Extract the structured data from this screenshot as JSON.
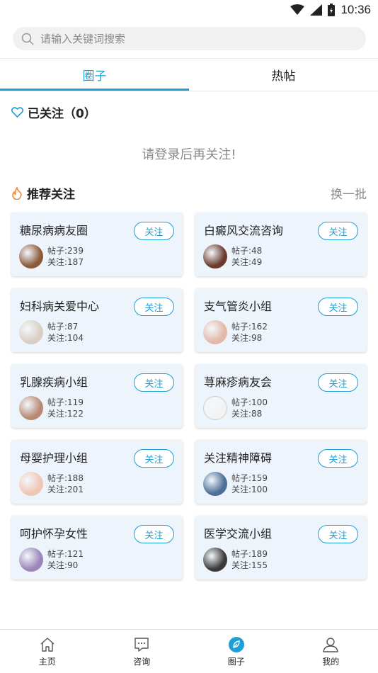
{
  "status_bar": {
    "time": "10:36"
  },
  "search": {
    "placeholder": "请输入关键词搜索"
  },
  "tabs": [
    {
      "label": "圈子",
      "active": true
    },
    {
      "label": "热帖",
      "active": false
    }
  ],
  "followed": {
    "title": "已关注（0）",
    "hint": "请登录后再关注!"
  },
  "recommend": {
    "title": "推荐关注",
    "refresh_label": "换一批"
  },
  "groups": [
    {
      "name": "糖尿病病友圈",
      "button": "关注",
      "posts": "帖子:239",
      "follows": "关注:187",
      "avatar_color": "#8a5a3a"
    },
    {
      "name": "白癜风交流咨询",
      "button": "关注",
      "posts": "帖子:48",
      "follows": "关注:49",
      "avatar_color": "#6b3b2e"
    },
    {
      "name": "妇科病关爱中心",
      "button": "关注",
      "posts": "帖子:87",
      "follows": "关注:104",
      "avatar_color": "#d8cfc2"
    },
    {
      "name": "支气管炎小组",
      "button": "关注",
      "posts": "帖子:162",
      "follows": "关注:98",
      "avatar_color": "#e3b8a8"
    },
    {
      "name": "乳腺疾病小组",
      "button": "关注",
      "posts": "帖子:119",
      "follows": "关注:122",
      "avatar_color": "#b88a74"
    },
    {
      "name": "荨麻疹病友会",
      "button": "关注",
      "posts": "帖子:100",
      "follows": "关注:88",
      "avatar_color": "#f2f2f2"
    },
    {
      "name": "母婴护理小组",
      "button": "关注",
      "posts": "帖子:188",
      "follows": "关注:201",
      "avatar_color": "#f0c6b6"
    },
    {
      "name": "关注精神障碍",
      "button": "关注",
      "posts": "帖子:159",
      "follows": "关注:100",
      "avatar_color": "#4b6f95"
    },
    {
      "name": "呵护怀孕女性",
      "button": "关注",
      "posts": "帖子:121",
      "follows": "关注:90",
      "avatar_color": "#9a86b8"
    },
    {
      "name": "医学交流小组",
      "button": "关注",
      "posts": "帖子:189",
      "follows": "关注:155",
      "avatar_color": "#3a3a3a"
    }
  ],
  "bottom_nav": [
    {
      "label": "主页",
      "icon": "home-icon",
      "active": false
    },
    {
      "label": "咨询",
      "icon": "chat-icon",
      "active": false
    },
    {
      "label": "圈子",
      "icon": "circle-leaf-icon",
      "active": true
    },
    {
      "label": "我的",
      "icon": "user-icon",
      "active": false
    }
  ],
  "colors": {
    "accent": "#1e9fd6",
    "card_bg": "#eef4fb",
    "fire": "#f08a3c"
  }
}
